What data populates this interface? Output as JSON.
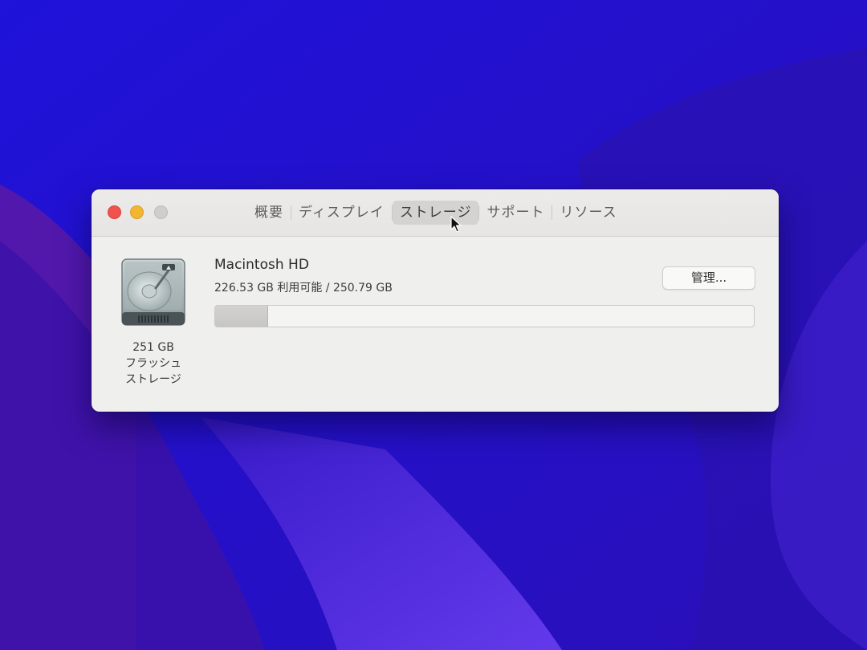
{
  "window": {
    "tabs": [
      {
        "label": "概要"
      },
      {
        "label": "ディスプレイ"
      },
      {
        "label": "ストレージ",
        "selected": true
      },
      {
        "label": "サポート"
      },
      {
        "label": "リソース"
      }
    ]
  },
  "disk": {
    "icon": "hard-drive-icon",
    "caption_size": "251 GB",
    "caption_line2": "フラッシュ",
    "caption_line3": "ストレージ"
  },
  "volume": {
    "name": "Macintosh HD",
    "info": "226.53 GB 利用可能 / 250.79 GB",
    "available_gb": 226.53,
    "total_gb": 250.79,
    "used_fraction": 0.097
  },
  "manage_button": {
    "label": "管理..."
  },
  "colors": {
    "close": "#f0524c",
    "minimize": "#f3b630",
    "zoom": "#cfcecc",
    "wallpaper": "#2410d6"
  }
}
